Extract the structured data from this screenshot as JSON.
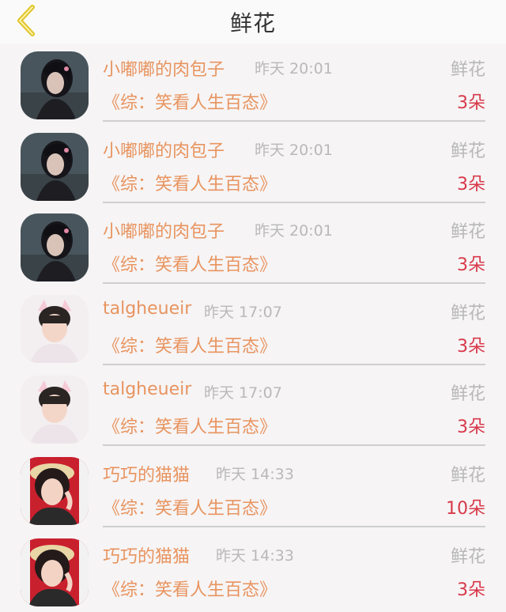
{
  "header": {
    "title": "鲜花",
    "back_icon": "chevron-left-icon",
    "accent": "#e0c52a"
  },
  "items": [
    {
      "name": "小嘟嘟的肉包子",
      "time": "昨天 20:01",
      "gift": "鲜花",
      "book": "《综：笑看人生百态》",
      "count": "3朵",
      "avatar": "girl-dark-hair"
    },
    {
      "name": "小嘟嘟的肉包子",
      "time": "昨天 20:01",
      "gift": "鲜花",
      "book": "《综：笑看人生百态》",
      "count": "3朵",
      "avatar": "girl-dark-hair"
    },
    {
      "name": "小嘟嘟的肉包子",
      "time": "昨天 20:01",
      "gift": "鲜花",
      "book": "《综：笑看人生百态》",
      "count": "3朵",
      "avatar": "girl-dark-hair"
    },
    {
      "name": "talgheueir",
      "time": "昨天 17:07",
      "gift": "鲜花",
      "book": "《综：笑看人生百态》",
      "count": "3朵",
      "avatar": "child-cat-ears"
    },
    {
      "name": "talgheueir",
      "time": "昨天 17:07",
      "gift": "鲜花",
      "book": "《综：笑看人生百态》",
      "count": "3朵",
      "avatar": "child-cat-ears"
    },
    {
      "name": "巧巧的猫猫",
      "time": "昨天 14:33",
      "gift": "鲜花",
      "book": "《综：笑看人生百态》",
      "count": "10朵",
      "avatar": "woman-straw-hat"
    },
    {
      "name": "巧巧的猫猫",
      "time": "昨天 14:33",
      "gift": "鲜花",
      "book": "《综：笑看人生百态》",
      "count": "3朵",
      "avatar": "woman-straw-hat"
    }
  ],
  "colors": {
    "name": "#e8945f",
    "time": "#b9b9b9",
    "count": "#d8394a",
    "background": "#f6f4f5"
  }
}
